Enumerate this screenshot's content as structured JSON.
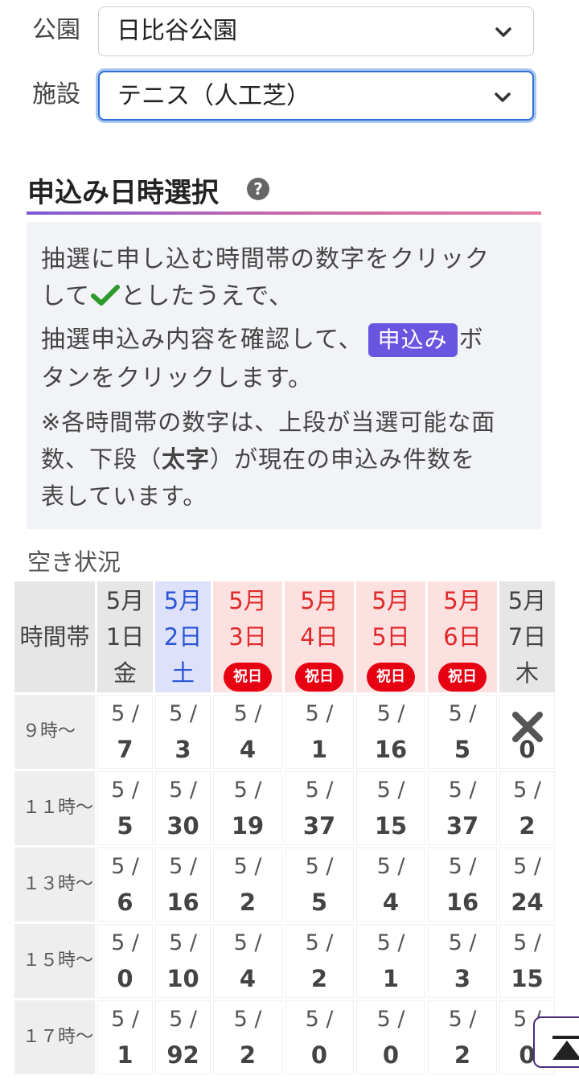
{
  "form": {
    "park_label": "公園",
    "park_value": "日比谷公園",
    "facility_label": "施設",
    "facility_value": "テニス（人工芝）"
  },
  "section": {
    "title": "申込み日時選択",
    "help_icon": "?"
  },
  "info": {
    "line1": "抽選に申し込む時間帯の数字をクリック",
    "line2_pre": "して",
    "line2_post": "としたうえで、",
    "line3_pre": "抽選申込み内容を確認して、",
    "apply_badge": "申込み",
    "line3_post": "ボ",
    "line4": "タンをクリックします。",
    "note1": "※各時間帯の数字は、上段が当選可能な面",
    "note2_pre": "数、下段（",
    "note2_bold": "太字",
    "note2_post": "）が現在の申込み件数を",
    "note3": "表しています。"
  },
  "availability": {
    "label": "空き状況",
    "time_header": "時間帯",
    "holiday_badge": "祝日",
    "days": [
      {
        "month": "5月",
        "day": "1日",
        "wd": "金",
        "type": "normal"
      },
      {
        "month": "5月",
        "day": "2日",
        "wd": "土",
        "type": "sat"
      },
      {
        "month": "5月",
        "day": "3日",
        "wd": "",
        "type": "hol"
      },
      {
        "month": "5月",
        "day": "4日",
        "wd": "",
        "type": "hol"
      },
      {
        "month": "5月",
        "day": "5日",
        "wd": "",
        "type": "hol"
      },
      {
        "month": "5月",
        "day": "6日",
        "wd": "",
        "type": "hol"
      },
      {
        "month": "5月",
        "day": "7日",
        "wd": "木",
        "type": "normal"
      }
    ],
    "rows": [
      {
        "time": "９時〜",
        "cells": [
          [
            "5 /",
            "7"
          ],
          [
            "5 /",
            "3"
          ],
          [
            "5 /",
            "4"
          ],
          [
            "5 /",
            "1"
          ],
          [
            "5 /",
            "16"
          ],
          [
            "5 /",
            "5"
          ],
          [
            "",
            "0"
          ]
        ]
      },
      {
        "time": "１１時〜",
        "cells": [
          [
            "5 /",
            "5"
          ],
          [
            "5 /",
            "30"
          ],
          [
            "5 /",
            "19"
          ],
          [
            "5 /",
            "37"
          ],
          [
            "5 /",
            "15"
          ],
          [
            "5 /",
            "37"
          ],
          [
            "5 /",
            "2"
          ]
        ]
      },
      {
        "time": "１３時〜",
        "cells": [
          [
            "5 /",
            "6"
          ],
          [
            "5 /",
            "16"
          ],
          [
            "5 /",
            "2"
          ],
          [
            "5 /",
            "5"
          ],
          [
            "5 /",
            "4"
          ],
          [
            "5 /",
            "16"
          ],
          [
            "5 /",
            "24"
          ]
        ]
      },
      {
        "time": "１５時〜",
        "cells": [
          [
            "5 /",
            "0"
          ],
          [
            "5 /",
            "10"
          ],
          [
            "5 /",
            "4"
          ],
          [
            "5 /",
            "2"
          ],
          [
            "5 /",
            "1"
          ],
          [
            "5 /",
            "3"
          ],
          [
            "5 /",
            "15"
          ]
        ]
      },
      {
        "time": "１７時〜",
        "cells": [
          [
            "5 /",
            "1"
          ],
          [
            "5 /",
            "92"
          ],
          [
            "5 /",
            "2"
          ],
          [
            "5 /",
            "0"
          ],
          [
            "5 /",
            "0"
          ],
          [
            "5 /",
            "2"
          ],
          [
            "5 /",
            "0"
          ]
        ]
      }
    ]
  },
  "icons": {
    "chevron": "chevron-down-icon",
    "check": "checkmark-icon",
    "unavailable": "x-mark-icon",
    "scroll_top": "scroll-to-top-icon"
  },
  "colors": {
    "accent": "#6a55e0",
    "holiday": "#e60012",
    "saturday": "#2a55d6",
    "check": "#2a9a2a"
  }
}
